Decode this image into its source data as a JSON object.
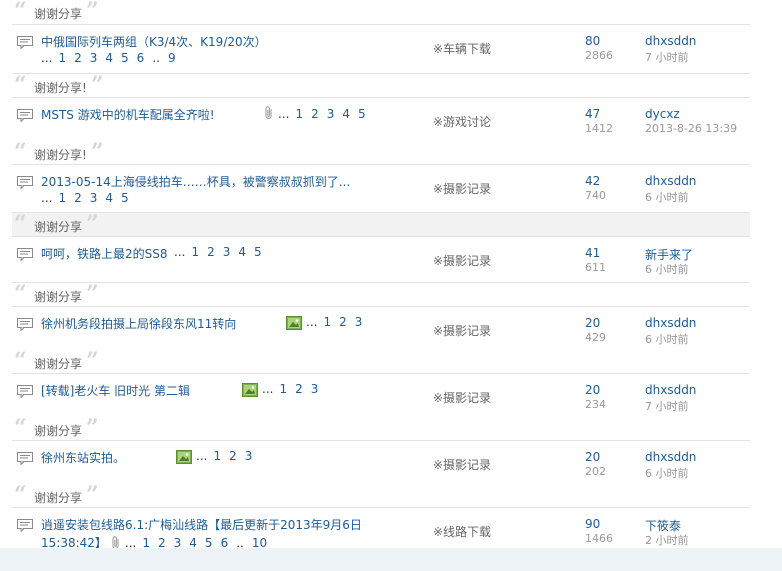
{
  "quote_rows": [
    "谢谢分享",
    "谢谢分享!",
    "谢谢分享!",
    "谢谢分享",
    "谢谢分享",
    "谢谢分享",
    "谢谢分享",
    "谢谢分享"
  ],
  "threads": [
    {
      "title": "中俄国际列车两组（K3/4次、K19/20次）",
      "pages": [
        "1",
        "2",
        "3",
        "4",
        "5",
        "6",
        "..",
        "9"
      ],
      "forum": "※车辆下载",
      "replies": "80",
      "views": "2866",
      "author": "dhxsddn",
      "time": "7 小时前",
      "attachment": false,
      "image": false
    },
    {
      "title": "MSTS 游戏中的机车配属全齐啦!",
      "pages": [
        "1",
        "2",
        "3",
        "4",
        "5"
      ],
      "forum": "※游戏讨论",
      "replies": "47",
      "views": "1412",
      "author": "dycxz",
      "time": "2013-8-26 13:39",
      "attachment": true,
      "image": false
    },
    {
      "title": "2013-05-14上海侵线拍车……杯具，被警察叔叔抓到了...",
      "pages": [
        "1",
        "2",
        "3",
        "4",
        "5"
      ],
      "forum": "※摄影记录",
      "replies": "42",
      "views": "740",
      "author": "dhxsddn",
      "time": "6 小时前",
      "attachment": false,
      "image": false
    },
    {
      "title": "呵呵，铁路上最2的SS8",
      "pages": [
        "1",
        "2",
        "3",
        "4",
        "5"
      ],
      "forum": "※摄影记录",
      "replies": "41",
      "views": "611",
      "author": "新手来了",
      "time": "6 小时前",
      "attachment": false,
      "image": false
    },
    {
      "title": "徐州机务段拍摄上局徐段东风11转向",
      "pages": [
        "1",
        "2",
        "3"
      ],
      "forum": "※摄影记录",
      "replies": "20",
      "views": "429",
      "author": "dhxsddn",
      "time": "6 小时前",
      "attachment": false,
      "image": true
    },
    {
      "title": "[转载]老火车 旧时光 第二辑",
      "pages": [
        "1",
        "2",
        "3"
      ],
      "forum": "※摄影记录",
      "replies": "20",
      "views": "234",
      "author": "dhxsddn",
      "time": "7 小时前",
      "attachment": false,
      "image": true
    },
    {
      "title": "徐州东站实拍。",
      "pages": [
        "1",
        "2",
        "3"
      ],
      "forum": "※摄影记录",
      "replies": "20",
      "views": "202",
      "author": "dhxsddn",
      "time": "6 小时前",
      "attachment": false,
      "image": true
    },
    {
      "title_line1": "逍遥安装包线路6.1:广梅汕线路【最后更新于2013年9月6日",
      "title_line2": "15:38:42】",
      "pages": [
        "1",
        "2",
        "3",
        "4",
        "5",
        "6",
        "..",
        "10"
      ],
      "forum": "※线路下载",
      "replies": "90",
      "views": "1466",
      "author": "下筱泰",
      "time": "2 小时前",
      "attachment": true,
      "image": false
    }
  ],
  "ellipsis": "...",
  "colors": {
    "link": "#1d5c96",
    "muted": "#999999",
    "quote": "#d6d6d6",
    "border": "#e3e3e3"
  },
  "icons": {
    "topic": "topic-bubble-icon",
    "attachment": "paperclip-icon",
    "image": "image-icon"
  }
}
